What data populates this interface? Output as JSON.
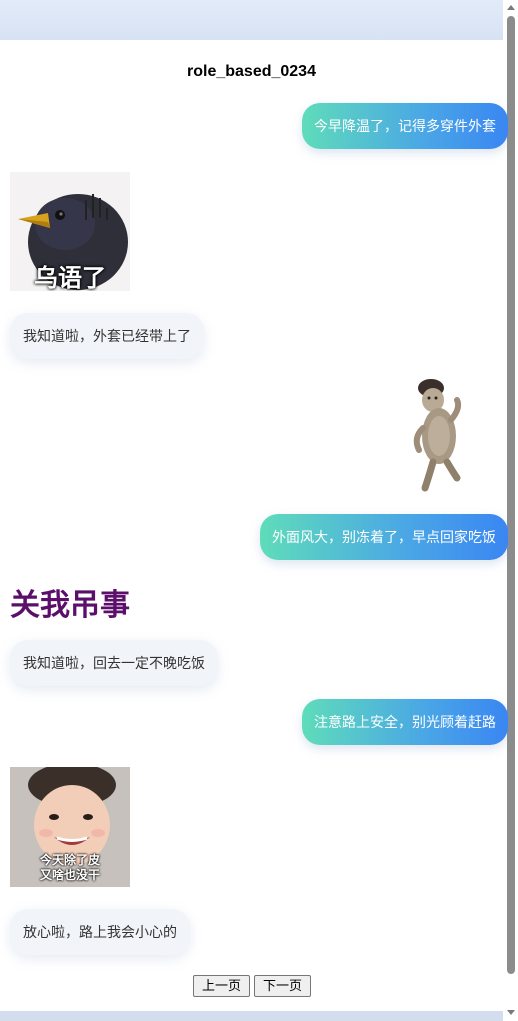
{
  "chat": {
    "title": "role_based_0234",
    "messages": [
      {
        "text": "今早降温了，记得多穿件外套"
      },
      {
        "sticker_caption": "乌语了"
      },
      {
        "text": "我知道啦，外套已经带上了"
      },
      {
        "sticker": "dancing-creature"
      },
      {
        "text": "外面风大，别冻着了，早点回家吃饭"
      },
      {
        "text": "关我吊事"
      },
      {
        "text": "我知道啦，回去一定不晚吃饭"
      },
      {
        "text": "注意路上安全，别光顾着赶路"
      },
      {
        "sticker_caption_line1": "今天除了皮",
        "sticker_caption_line2": "又啥也没干"
      },
      {
        "text": "放心啦，路上我会小心的"
      }
    ]
  },
  "pagination": {
    "prev_label": "上一页",
    "next_label": "下一页"
  },
  "colors": {
    "bubble_gradient_start": "#5fdcba",
    "bubble_gradient_end": "#3a86f2",
    "left_bubble_bg": "#f1f4f9",
    "text_sticker_color": "#5b0f6b"
  }
}
